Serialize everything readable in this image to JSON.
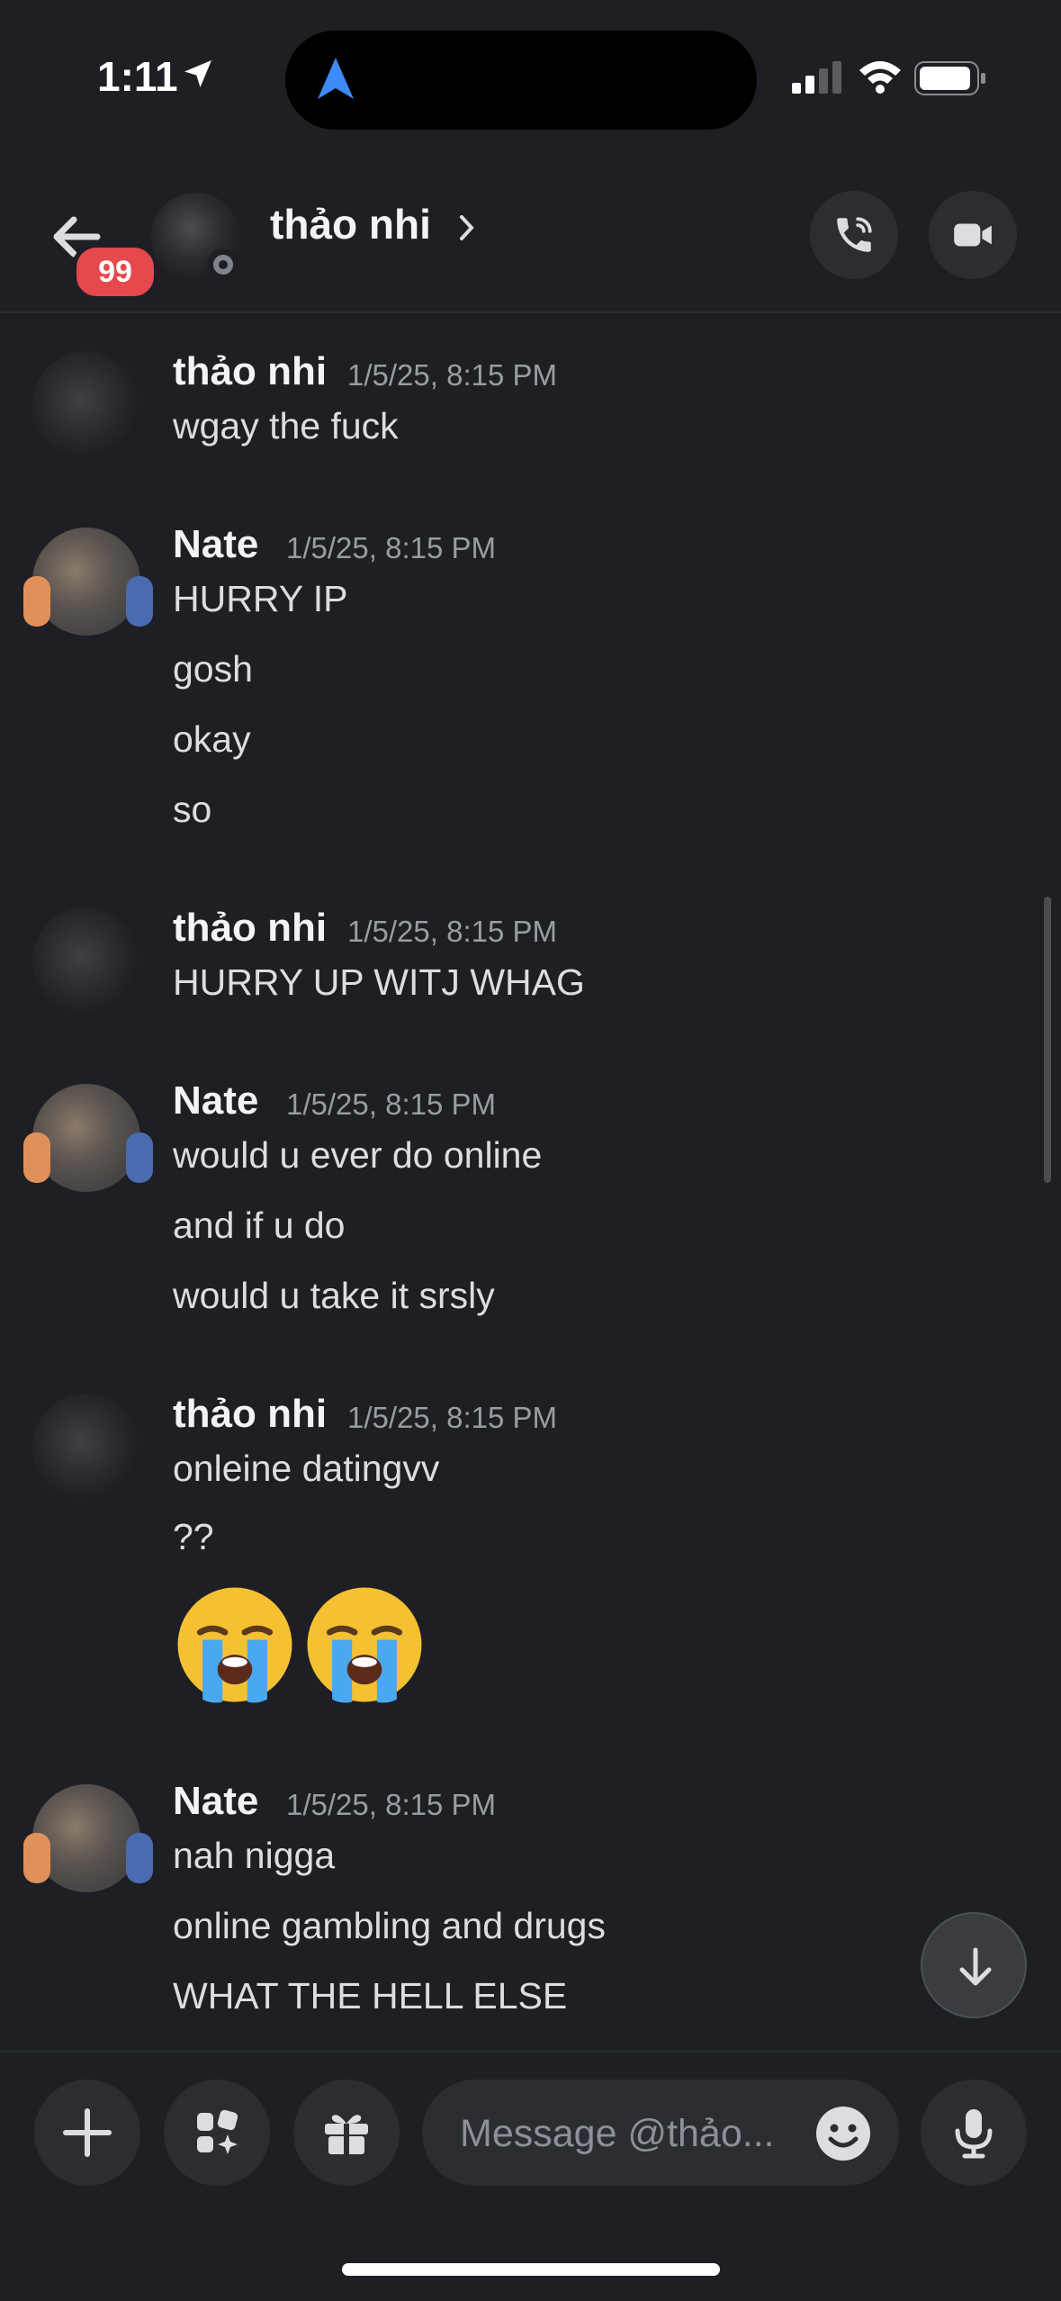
{
  "status": {
    "time": "1:11"
  },
  "header": {
    "title": "thảo nhi",
    "badge": "99"
  },
  "messages": [
    {
      "author": "thảo nhi",
      "time": "1/5/25, 8:15 PM",
      "avatar": "black-cat",
      "lines": [
        "wgay the fuck"
      ]
    },
    {
      "author": "Nate",
      "time": "1/5/25, 8:15 PM",
      "avatar": "cat-with-controller",
      "lines": [
        "HURRY IP",
        "gosh",
        "okay",
        "so"
      ]
    },
    {
      "author": "thảo nhi",
      "time": "1/5/25, 8:15 PM",
      "avatar": "black-cat",
      "lines": [
        "HURRY UP WITJ WHAG"
      ]
    },
    {
      "author": "Nate",
      "time": "1/5/25, 8:15 PM",
      "avatar": "cat-with-controller",
      "lines": [
        "would u ever do online",
        "and if u do",
        "would u take it srsly"
      ]
    },
    {
      "author": "thảo nhi",
      "time": "1/5/25, 8:15 PM",
      "avatar": "black-cat",
      "lines": [
        "onleine datingvv",
        "??"
      ],
      "emoji": [
        "😭",
        "😭"
      ]
    },
    {
      "author": "Nate",
      "time": "1/5/25, 8:15 PM",
      "avatar": "cat-with-controller",
      "lines": [
        "nah nigga",
        "online gambling and drugs",
        "WHAT THE HELL ELSE"
      ]
    }
  ],
  "composer": {
    "placeholder": "Message @thảo..."
  },
  "icons": [
    "back-arrow-icon",
    "phone-icon",
    "video-icon",
    "plus-icon",
    "apps-icon",
    "gift-icon",
    "smiley-icon",
    "mic-icon",
    "arrow-down-icon"
  ],
  "colors": {
    "background": "#1e1f24",
    "badge": "#e5484d",
    "accent": "#4f8cf7"
  }
}
